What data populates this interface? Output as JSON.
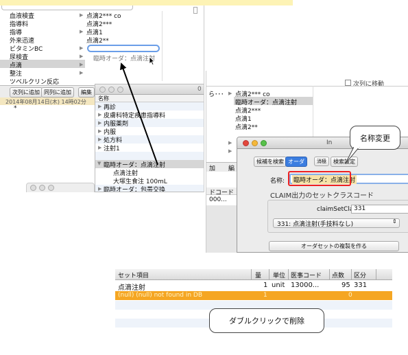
{
  "w1": {
    "left_items": [
      "血液検査",
      "指導料",
      "指導",
      "外来迅速",
      "ビタミンBC",
      "尿検査",
      "点滴",
      "整注",
      "ツベルクリン反応"
    ],
    "right_items": [
      "点滴2*** co",
      "点滴2***",
      "点滴1",
      "点滴2**"
    ],
    "hint": "臨時オーダ：点滴注射",
    "buttons": [
      "次列に追加",
      "同列に追加",
      "編集"
    ],
    "date": "2014年08月14日(木) 14時02分",
    "asterisk": "*",
    "col_header": "名称",
    "tree": [
      "再診",
      "皮膚科特定疾患指導料",
      "内服薬剤",
      "内服",
      "処方料",
      "注射1",
      "臨時オーダ：点滴注射",
      "点滴注射",
      "大塚生食注 100mL",
      "臨時オーダ：包帯交換"
    ],
    "zero": "0"
  },
  "w2": {
    "checkbox_label": "次列に移動",
    "prefix": "ら･･･",
    "items": [
      "点滴2*** co",
      "臨時オーダ：点滴注射",
      "点滴2***",
      "点滴1",
      "点滴2**"
    ],
    "tab_partial": "加",
    "tab_partial2": "編",
    "col_partial": "ドコード",
    "col_partial_val": "000...",
    "title_partial": "In",
    "tabs": [
      "候補を検索",
      "オーダ",
      "消極",
      "検索設定"
    ],
    "name_label": "名称:",
    "name_value": "臨時オーダ：点滴注射",
    "claim_header": "CLAIM出力のセットクラスコード",
    "claim_label": "claimSetClass:",
    "claim_value": "331",
    "select_value": "331: 点滴注射(手技料なし)",
    "copy_button": "オーダセットの複製を作る"
  },
  "callout1": "名称変更",
  "callout2": "ダブルクリックで削除",
  "table": {
    "headers": [
      "セット項目",
      "量",
      "単位",
      "医事コード",
      "点数",
      "区分"
    ],
    "rows": [
      [
        "点滴注射",
        "1",
        "unit",
        "13000...",
        "95",
        "331"
      ],
      [
        "(null) (null) not found in DB",
        "1",
        "",
        "",
        "0",
        ""
      ]
    ]
  }
}
